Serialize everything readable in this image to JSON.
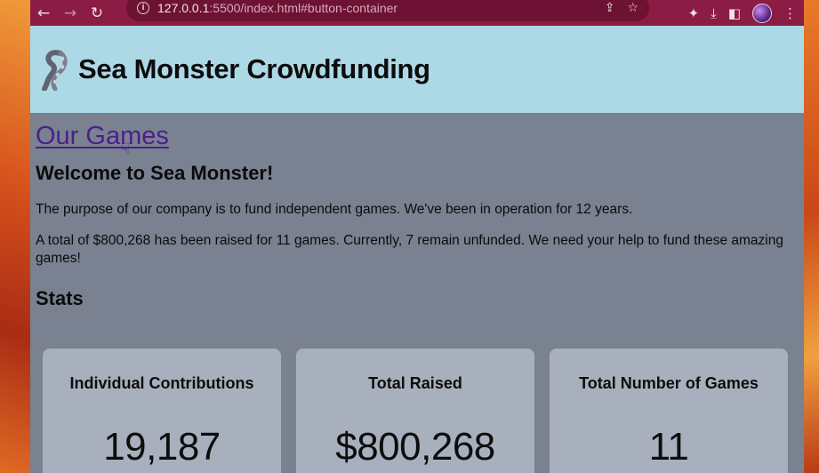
{
  "browser": {
    "url_host": "127.0.0.1",
    "url_rest": ":5500/index.html#button-container",
    "back_icon": "arrow-left-icon",
    "forward_icon": "arrow-right-icon",
    "reload_icon": "reload-icon"
  },
  "header": {
    "title": "Sea Monster Crowdfunding",
    "logo_icon": "tentacle-logo-icon"
  },
  "main": {
    "games_link": "Our Games",
    "welcome_heading": "Welcome to Sea Monster!",
    "intro_paragraph": "The purpose of our company is to fund independent games. We've been in operation for 12 years.",
    "summary_paragraph": "A total of $800,268 has been raised for 11 games. Currently, 7 remain unfunded. We need your help to fund these amazing games!",
    "stats_heading": "Stats"
  },
  "stats": [
    {
      "label": "Individual Contributions",
      "value": "19,187"
    },
    {
      "label": "Total Raised",
      "value": "$800,268"
    },
    {
      "label": "Total Number of Games",
      "value": "11"
    }
  ],
  "colors": {
    "toolbar": "#8b1c44",
    "header_bg": "#add8e6",
    "page_bg": "#7a8190",
    "card_bg": "#a9b0bd",
    "link": "#4c1f8a"
  }
}
